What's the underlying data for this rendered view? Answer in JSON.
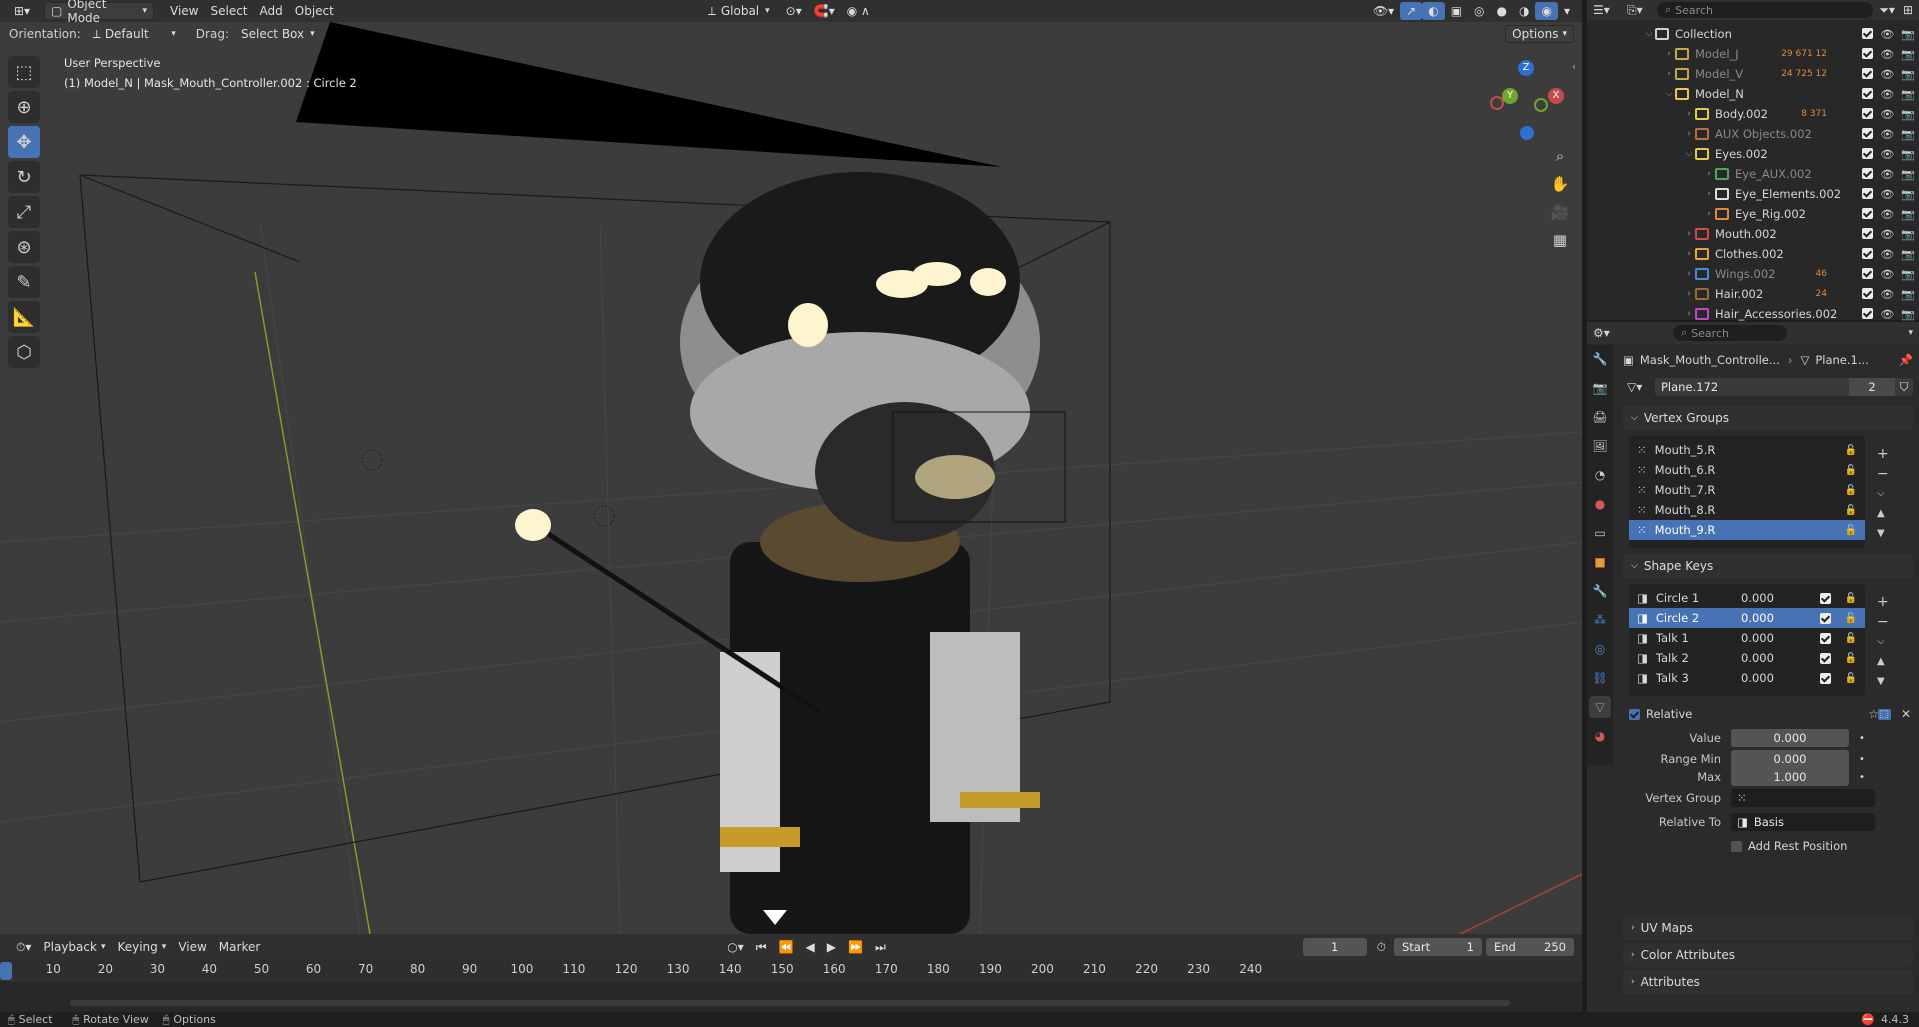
{
  "header": {
    "mode": "Object Mode",
    "menus": [
      "View",
      "Select",
      "Add",
      "Object"
    ],
    "transform": "Global",
    "orientation_label": "Orientation:",
    "orientation_value": "Default",
    "drag_label": "Drag:",
    "drag_value": "Select Box",
    "options": "Options"
  },
  "viewport": {
    "perspective": "User Perspective",
    "object_info": "(1) Model_N | Mask_Mouth_Controller.002 : Circle 2",
    "gizmo": {
      "z": "Z",
      "y": "Y",
      "x": "X"
    }
  },
  "outliner": {
    "search_placeholder": "Search",
    "rows": [
      {
        "name": "Collection",
        "indent": 0,
        "expanded": true,
        "color": "#cfcfcf",
        "stats": ""
      },
      {
        "name": "Model_J",
        "indent": 1,
        "expanded": false,
        "color": "#c8a650",
        "stats": "29 671 12",
        "dim": true
      },
      {
        "name": "Model_V",
        "indent": 1,
        "expanded": false,
        "color": "#c8a650",
        "stats": "24 725 12",
        "dim": true
      },
      {
        "name": "Model_N",
        "indent": 1,
        "expanded": true,
        "color": "#e8c94a",
        "stats": ""
      },
      {
        "name": "Body.002",
        "indent": 2,
        "expanded": false,
        "color": "#e8c94a",
        "stats": "8 371"
      },
      {
        "name": "AUX Objects.002",
        "indent": 2,
        "expanded": false,
        "color": "#c06a3f",
        "stats": "",
        "dim": true
      },
      {
        "name": "Eyes.002",
        "indent": 2,
        "expanded": true,
        "color": "#e8c94a",
        "stats": ""
      },
      {
        "name": "Eye_AUX.002",
        "indent": 3,
        "expanded": false,
        "color": "#4fa85a",
        "stats": "",
        "dim": true
      },
      {
        "name": "Eye_Elements.002",
        "indent": 3,
        "expanded": false,
        "color": "#dddddd",
        "stats": ""
      },
      {
        "name": "Eye_Rig.002",
        "indent": 3,
        "expanded": false,
        "color": "#e08a3a",
        "stats": ""
      },
      {
        "name": "Mouth.002",
        "indent": 2,
        "expanded": false,
        "color": "#d24a4a",
        "stats": ""
      },
      {
        "name": "Clothes.002",
        "indent": 2,
        "expanded": false,
        "color": "#e8a53a",
        "stats": ""
      },
      {
        "name": "Wings.002",
        "indent": 2,
        "expanded": false,
        "color": "#4a8ad2",
        "stats": "46",
        "dim": true
      },
      {
        "name": "Hair.002",
        "indent": 2,
        "expanded": false,
        "color": "#9a6a3a",
        "stats": "24"
      },
      {
        "name": "Hair_Accessories.002",
        "indent": 2,
        "expanded": false,
        "color": "#c04ac0",
        "stats": ""
      }
    ]
  },
  "properties": {
    "search_placeholder": "Search",
    "breadcrumb_object": "Mask_Mouth_Controlle...",
    "breadcrumb_data": "Plane.1...",
    "mesh_name": "Plane.172",
    "mesh_users": "2",
    "vertex_groups_title": "Vertex Groups",
    "vertex_groups": [
      "Mouth_5.R",
      "Mouth_6.R",
      "Mouth_7.R",
      "Mouth_8.R",
      "Mouth_9.R"
    ],
    "vertex_group_selected": 4,
    "shape_keys_title": "Shape Keys",
    "shape_keys": [
      {
        "name": "Circle 1",
        "value": "0.000"
      },
      {
        "name": "Circle 2",
        "value": "0.000"
      },
      {
        "name": "Talk 1",
        "value": "0.000"
      },
      {
        "name": "Talk 2",
        "value": "0.000"
      },
      {
        "name": "Talk 3",
        "value": "0.000"
      }
    ],
    "shape_key_selected": 1,
    "relative_label": "Relative",
    "value_label": "Value",
    "value": "0.000",
    "range_min_label": "Range Min",
    "range_min": "0.000",
    "max_label": "Max",
    "max": "1.000",
    "vertex_group_label": "Vertex Group",
    "relative_to_label": "Relative To",
    "relative_to": "Basis",
    "add_rest_position": "Add Rest Position",
    "uv_maps": "UV Maps",
    "color_attributes": "Color Attributes",
    "attributes": "Attributes"
  },
  "timeline": {
    "menus": [
      "Playback",
      "Keying",
      "View",
      "Marker"
    ],
    "current_frame": "1",
    "start_label": "Start",
    "start": "1",
    "end_label": "End",
    "end": "250",
    "ruler": [
      "1",
      "10",
      "20",
      "30",
      "40",
      "50",
      "60",
      "70",
      "80",
      "90",
      "100",
      "110",
      "120",
      "130",
      "140",
      "150",
      "160",
      "170",
      "180",
      "190",
      "200",
      "210",
      "220",
      "230",
      "240"
    ]
  },
  "status": {
    "select": "Select",
    "rotate": "Rotate View",
    "options": "Options",
    "version": "4.4.3"
  }
}
